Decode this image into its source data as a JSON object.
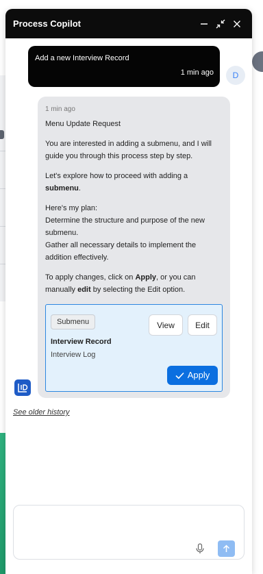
{
  "header": {
    "title": "Process Copilot",
    "icons": [
      "minimize-icon",
      "collapse-icon",
      "close-icon"
    ]
  },
  "user_message": {
    "text": "Add a new Interview Record",
    "time": "1 min ago",
    "avatar_initial": "D"
  },
  "bot_message": {
    "time": "1 min ago",
    "heading": "Menu Update Request",
    "p1": "You are interested in adding a submenu, and I will guide you through this process step by step.",
    "p2_pre": "Let's explore how to proceed with adding a ",
    "p2_bold": "submenu",
    "p2_post": ".",
    "plan_label": "Here's my plan:",
    "plan_step1": "Determine the structure and purpose of the new submenu.",
    "plan_step2": "Gather all necessary details to implement the addition effectively.",
    "apply_pre": "To apply changes, click on ",
    "apply_bold1": "Apply",
    "apply_mid": ", or you can manually ",
    "apply_bold2": "edit",
    "apply_post": " by selecting the Edit option."
  },
  "card": {
    "chip": "Submenu",
    "title": "Interview Record",
    "subtitle": "Interview Log",
    "view_label": "View",
    "edit_label": "Edit",
    "apply_label": "Apply"
  },
  "history_link": "See older history",
  "composer": {
    "placeholder": ""
  },
  "colors": {
    "header_bg": "#0c0c0c",
    "user_bubble": "#050505",
    "bot_bubble": "#e6e7ea",
    "card_bg": "#e3f1fc",
    "card_border": "#2b86e0",
    "apply_button": "#0b6fe0",
    "send_button": "#8fbcf3",
    "user_avatar_text": "#3b82f6"
  }
}
